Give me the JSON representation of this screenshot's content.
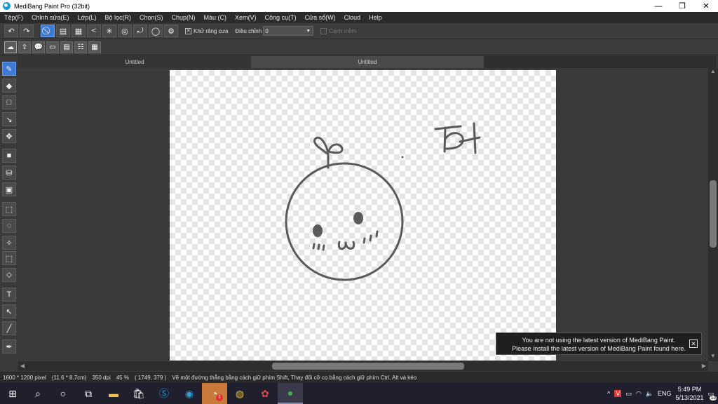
{
  "window": {
    "title": "MediBang Paint Pro (32bit)",
    "minimize": "—",
    "restore": "❐",
    "close": "✕"
  },
  "menu": [
    "Tệp(F)",
    "Chỉnh sửa(E)",
    "Lớp(L)",
    "Bộ lọc(R)",
    "Chọn(S)",
    "Chụp(N)",
    "Màu (C)",
    "Xem(V)",
    "Công cụ(T)",
    "Cửa sổ(W)",
    "Cloud",
    "Help"
  ],
  "toolbar": {
    "antialias_label": "Khử răng cưa",
    "antialias_checked": true,
    "adjust_label": "Điều chỉnh",
    "adjust_value": "0",
    "smooth_label": "Cạnh mềm",
    "smooth_checked": false
  },
  "tabs": [
    {
      "label": "Untitled",
      "active": false
    },
    {
      "label": "Untitled",
      "active": true
    }
  ],
  "notice": {
    "line1": "You are not using the latest version of MediBang Paint.",
    "line2": "Please install the latest version of MediBang Paint found here."
  },
  "status": {
    "size": "1600 * 1200 pixel",
    "cm": "(11.6 * 8.7cm)",
    "dpi": "350 dpi",
    "zoom": "45 %",
    "coords": "( 1749, 379 )",
    "hint": "Vẽ một đường thẳng bằng cách giữ phím Shift, Thay đổi cỡ cọ bằng cách giữ phím Ctrl, Alt và kéo"
  },
  "taskbar": {
    "badge": "1",
    "lang": "ENG",
    "time": "5:49 PM",
    "date": "5/13/2021",
    "notif_count": "13"
  },
  "colors": {
    "accent": "#3d7bd6",
    "stroke": "#5a5a5a"
  }
}
